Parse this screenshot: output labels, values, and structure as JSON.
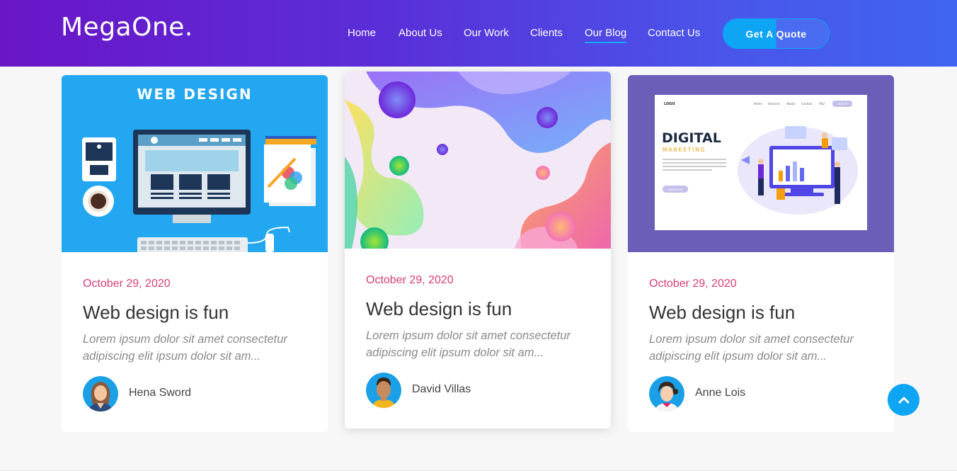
{
  "header": {
    "logo": "MegaOne.",
    "nav": [
      {
        "label": "Home"
      },
      {
        "label": "About Us"
      },
      {
        "label": "Our Work"
      },
      {
        "label": "Clients"
      },
      {
        "label": "Our Blog",
        "active": true
      },
      {
        "label": "Contact Us"
      }
    ],
    "cta": "Get A Quote"
  },
  "posts": [
    {
      "image": "web-design-illustration",
      "image_heading": "WEB DESIGN",
      "date": "October 29, 2020",
      "title": "Web design is fun",
      "excerpt": "Lorem ipsum dolor sit amet consectetur adipiscing elit ipsum dolor sit am...",
      "author": "Hena Sword"
    },
    {
      "image": "abstract-fluid-shapes",
      "date": "October 29, 2020",
      "title": "Web design is fun",
      "excerpt": "Lorem ipsum dolor sit amet consectetur adipiscing elit ipsum dolor sit am...",
      "author": "David Villas"
    },
    {
      "image": "digital-marketing-illustration",
      "image_heading": "DIGITAL",
      "image_subheading": "MARKETING",
      "image_logo": "LOGO",
      "image_nav": [
        "Home",
        "Services",
        "About",
        "Contact",
        "FAQ"
      ],
      "image_button": "SIGN UP",
      "image_cta": "LEARN MORE",
      "date": "October 29, 2020",
      "title": "Web design is fun",
      "excerpt": "Lorem ipsum dolor sit amet consectetur adipiscing elit ipsum dolor sit am...",
      "author": "Anne Lois"
    }
  ],
  "colors": {
    "accent": "#0ea5f5",
    "date": "#d63d77",
    "header_start": "#6a16c7",
    "header_end": "#3f64f0"
  },
  "icons": {
    "scroll_top": "chevron-up-icon"
  }
}
